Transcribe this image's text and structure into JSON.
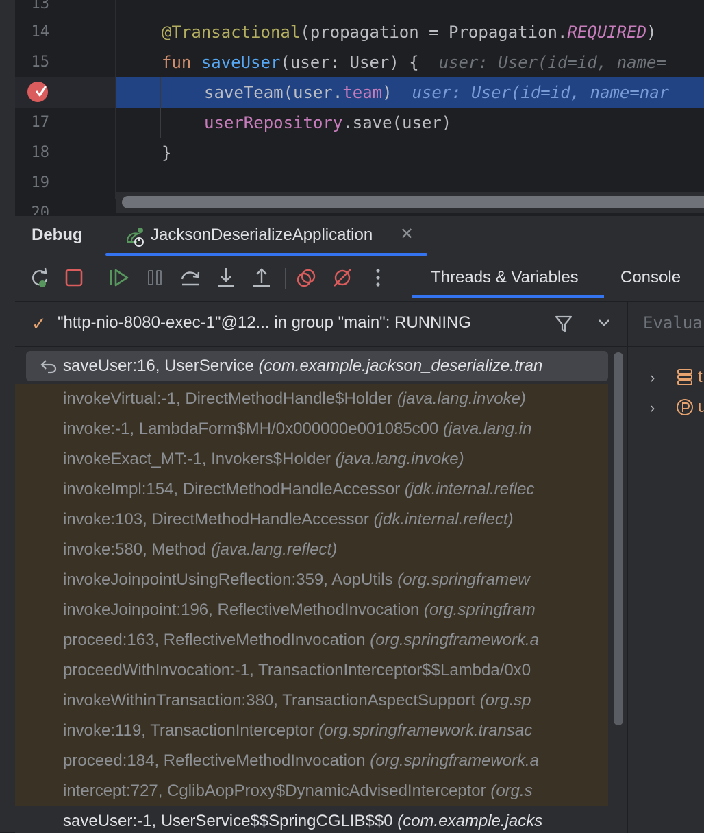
{
  "editor": {
    "line_numbers": [
      "13",
      "14",
      "15",
      "17",
      "18",
      "19",
      "20"
    ],
    "lines": {
      "l14": {
        "annotation": "@Transactional",
        "open": "(propagation = Propagation.",
        "const": "REQUIRED",
        "close": ")"
      },
      "l15": {
        "kw": "fun ",
        "fn": "saveUser",
        "params": "(user: User) {",
        "hint": "user: User(id=id, name="
      },
      "l16": {
        "call": "saveTeam(user.",
        "prop": "team",
        "close": ")",
        "hint": "user: User(id=id, name=nar"
      },
      "l17": {
        "prop": "userRepository",
        "rest": ".save(user)"
      },
      "l18": {
        "brace": "}"
      }
    }
  },
  "debug": {
    "title": "Debug",
    "session_name": "JacksonDeserializeApplication",
    "tabs": [
      "Threads & Variables",
      "Console"
    ],
    "active_tab": "Threads & Variables",
    "thread_label": "\"http-nio-8080-exec-1\"@12... in group \"main\": RUNNING",
    "evaluate_placeholder": "Evalua",
    "frames": [
      {
        "method": "saveUser:16, UserService ",
        "pkg": "(com.example.jackson_deserialize.tran"
      },
      {
        "method": "invokeVirtual:-1, DirectMethodHandle$Holder ",
        "pkg": "(java.lang.invoke)"
      },
      {
        "method": "invoke:-1, LambdaForm$MH/0x000000e001085c00 ",
        "pkg": "(java.lang.in"
      },
      {
        "method": "invokeExact_MT:-1, Invokers$Holder ",
        "pkg": "(java.lang.invoke)"
      },
      {
        "method": "invokeImpl:154, DirectMethodHandleAccessor ",
        "pkg": "(jdk.internal.reflec"
      },
      {
        "method": "invoke:103, DirectMethodHandleAccessor ",
        "pkg": "(jdk.internal.reflect)"
      },
      {
        "method": "invoke:580, Method ",
        "pkg": "(java.lang.reflect)"
      },
      {
        "method": "invokeJoinpointUsingReflection:359, AopUtils ",
        "pkg": "(org.springframew"
      },
      {
        "method": "invokeJoinpoint:196, ReflectiveMethodInvocation ",
        "pkg": "(org.springfram"
      },
      {
        "method": "proceed:163, ReflectiveMethodInvocation ",
        "pkg": "(org.springframework.a"
      },
      {
        "method": "proceedWithInvocation:-1, TransactionInterceptor$$Lambda/0x0",
        "pkg": ""
      },
      {
        "method": "invokeWithinTransaction:380, TransactionAspectSupport ",
        "pkg": "(org.sp"
      },
      {
        "method": "invoke:119, TransactionInterceptor ",
        "pkg": "(org.springframework.transac"
      },
      {
        "method": "proceed:184, ReflectiveMethodInvocation ",
        "pkg": "(org.springframework.a"
      },
      {
        "method": "intercept:727, CglibAopProxy$DynamicAdvisedInterceptor ",
        "pkg": "(org.s"
      },
      {
        "method": "saveUser:-1, UserService$$SpringCGLIB$$0 ",
        "pkg": "(com.example.jacks"
      }
    ],
    "variables": [
      {
        "icon": "field-stack-icon",
        "name": "t"
      },
      {
        "icon": "parameter-icon",
        "name": "u"
      }
    ]
  },
  "colors": {
    "accent": "#3574f0",
    "execution_line": "#214283",
    "library_frame_bg": "#3a3325",
    "breakpoint": "#db5c5c"
  }
}
